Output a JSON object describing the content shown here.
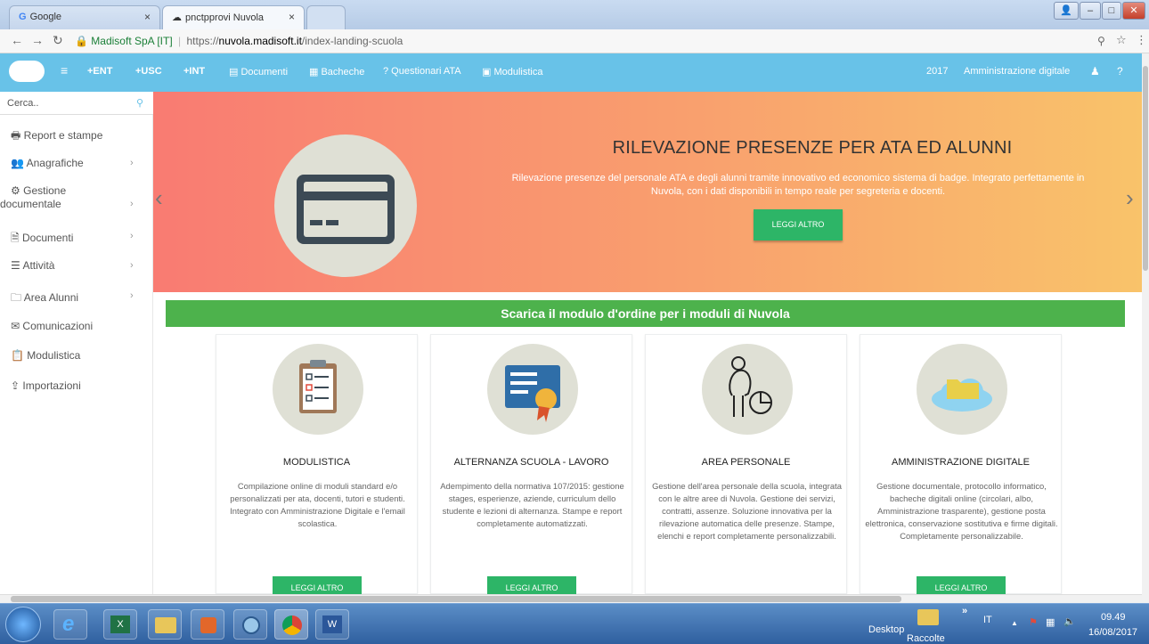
{
  "browser": {
    "tabs": [
      {
        "label": "Google"
      },
      {
        "label": "pnctpprovi Nuvola"
      },
      {
        "label": ""
      }
    ],
    "tab_close": "×",
    "address": {
      "secure_label": "Madisoft SpA [IT]",
      "separator": "|",
      "scheme": "https://",
      "host": "nuvola.madisoft.it",
      "path": "/index-landing-scuola"
    },
    "nav_icons": [
      "back-icon",
      "forward-icon",
      "reload-icon"
    ],
    "right_icons": [
      "zoom-icon",
      "star-icon",
      "menu-icon"
    ]
  },
  "topnav": {
    "items": [
      {
        "label": "+ENT"
      },
      {
        "label": "+USC"
      },
      {
        "label": "+INT"
      },
      {
        "label": "Documenti"
      },
      {
        "label": "Bacheche"
      },
      {
        "label": "? Questionari ATA"
      },
      {
        "label": "Modulistica"
      }
    ],
    "year": "2017",
    "admin": "Amministrazione digitale",
    "menu_glyph": "≡"
  },
  "sidebar": {
    "search_placeholder": "Cerca..",
    "items": [
      {
        "label": "Report e stampe",
        "icon": "printer-icon",
        "chevron": ""
      },
      {
        "label": "Anagrafiche",
        "icon": "users-icon",
        "chevron": "›"
      },
      {
        "label": "Gestione documentale",
        "label_line1": "Gestione",
        "label_line2": "documentale",
        "icon": "gears-icon",
        "chevron": "›"
      },
      {
        "label": "Documenti",
        "icon": "document-icon",
        "chevron": "›"
      },
      {
        "label": "Attività",
        "icon": "list-icon",
        "chevron": "›"
      },
      {
        "label": "Area Alunni",
        "icon": "folder-icon",
        "chevron": "›"
      },
      {
        "label": "Comunicazioni",
        "icon": "envelope-icon",
        "chevron": ""
      },
      {
        "label": "Modulistica",
        "icon": "clipboard-icon",
        "chevron": ""
      },
      {
        "label": "Importazioni",
        "icon": "upload-icon",
        "chevron": ""
      }
    ]
  },
  "hero": {
    "title": "RILEVAZIONE PRESENZE PER ATA ED ALUNNI",
    "description": "Rilevazione presenze del personale ATA e degli alunni tramite innovativo ed economico sistema di badge. Integrato perfettamente in Nuvola, con i dati disponibili in tempo reale per segreteria e docenti.",
    "button": "LEGGI ALTRO",
    "prev": "‹",
    "next": "›",
    "icon": "card-icon"
  },
  "banner": {
    "text": "Scarica il modulo d'ordine per i moduli di Nuvola"
  },
  "cards": [
    {
      "title": "MODULISTICA",
      "description": "Compilazione online di moduli standard e/o personalizzati per ata, docenti, tutori e studenti. Integrato con Amministrazione Digitale e l'email scolastica.",
      "button": "LEGGI ALTRO",
      "icon": "checklist-icon"
    },
    {
      "title": "ALTERNANZA SCUOLA - LAVORO",
      "description": "Adempimento della normativa 107/2015: gestione stages, esperienze, aziende, curriculum dello studente e lezioni di alternanza. Stampe e report completamente automatizzati.",
      "button": "LEGGI ALTRO",
      "icon": "certificate-icon"
    },
    {
      "title": "AREA PERSONALE",
      "description": "Gestione dell'area personale della scuola, integrata con le altre aree di Nuvola. Gestione dei servizi, contratti, assenze. Soluzione innovativa per la rilevazione automatica delle presenze. Stampe, elenchi e report completamente personalizzabili.",
      "button": "",
      "icon": "person-chart-icon"
    },
    {
      "title": "AMMINISTRAZIONE DIGITALE",
      "description": "Gestione documentale, protocollo informatico, bacheche digitali online (circolari, albo, Amministrazione trasparente), gestione posta elettronica, conservazione sostitutiva e firme digitali. Completamente personalizzabile.",
      "button": "LEGGI ALTRO",
      "icon": "cloud-folder-icon"
    }
  ],
  "taskbar": {
    "desktop": "Desktop",
    "raccolte": "Raccolte",
    "lang": "IT",
    "time": "09.49",
    "date": "16/08/2017",
    "chevrons": "»",
    "tray_up": "▲"
  }
}
